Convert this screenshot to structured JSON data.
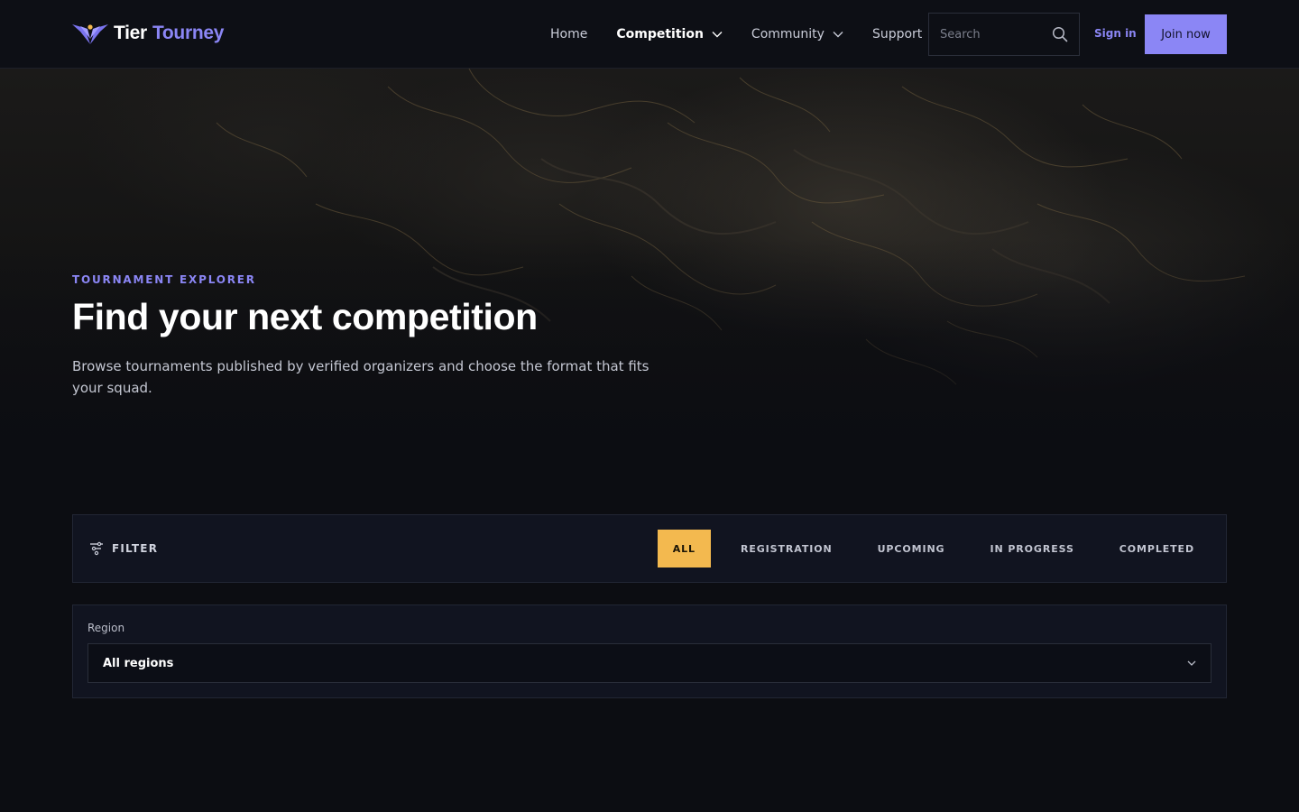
{
  "brand": {
    "name_part1": "Tier",
    "name_part2": "Tourney",
    "logo_icon": "winged-v-logo"
  },
  "nav": {
    "items": [
      {
        "label": "Home",
        "active": false,
        "dropdown": false
      },
      {
        "label": "Competition",
        "active": true,
        "dropdown": true
      },
      {
        "label": "Community",
        "active": false,
        "dropdown": true
      },
      {
        "label": "Support",
        "active": false,
        "dropdown": false
      }
    ]
  },
  "search": {
    "placeholder": "Search",
    "value": "",
    "icon": "search-icon"
  },
  "auth": {
    "signin_label": "Sign in",
    "join_label": "Join now"
  },
  "hero": {
    "eyebrow": "TOURNAMENT EXPLORER",
    "title": "Find your next competition",
    "subtitle": "Browse tournaments published by verified organizers and choose the format that fits your squad."
  },
  "filter": {
    "label": "FILTER",
    "icon": "filter-icon",
    "tabs": [
      {
        "label": "ALL",
        "active": true
      },
      {
        "label": "REGISTRATION",
        "active": false
      },
      {
        "label": "UPCOMING",
        "active": false
      },
      {
        "label": "IN PROGRESS",
        "active": false
      },
      {
        "label": "COMPLETED",
        "active": false
      }
    ]
  },
  "region": {
    "label": "Region",
    "selected": "All regions"
  },
  "colors": {
    "accent": "#8b86f5",
    "active_tab": "#f3b94f",
    "background": "#0c0d12",
    "panel": "#111420"
  }
}
